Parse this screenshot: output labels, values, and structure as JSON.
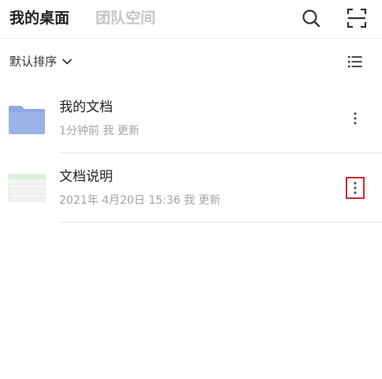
{
  "header": {
    "tabs": [
      {
        "label": "我的桌面",
        "active": true
      },
      {
        "label": "团队空间",
        "active": false
      }
    ],
    "icons": [
      "search-icon",
      "scan-icon"
    ]
  },
  "sortbar": {
    "sort_label": "默认排序",
    "icons": [
      "chevron-down-icon",
      "list-view-icon"
    ]
  },
  "files": [
    {
      "name": "我的文档",
      "meta": "1分钟前 我 更新",
      "type": "folder",
      "thumb_color": "#8fa9e0"
    },
    {
      "name": "文档说明",
      "meta": "2021年 4月20日 15:36 我 更新",
      "type": "spreadsheet",
      "more_highlighted": true,
      "highlight_color": "#d9262c"
    }
  ]
}
